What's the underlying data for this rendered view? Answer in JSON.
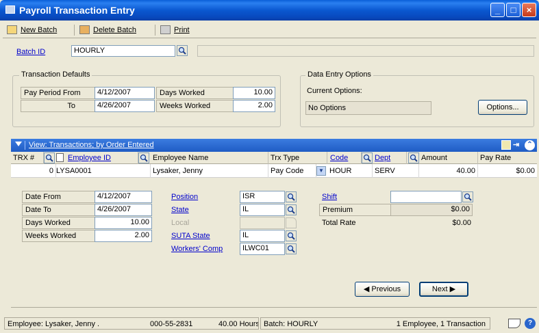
{
  "window": {
    "title": "Payroll Transaction Entry",
    "controls": {
      "minimize": "_",
      "maximize": "□",
      "close": "×"
    }
  },
  "toolbar": {
    "new_batch": "New Batch",
    "delete_batch": "Delete Batch",
    "print": "Print"
  },
  "batch": {
    "label": "Batch ID",
    "value": "HOURLY",
    "comment": ""
  },
  "defaults": {
    "group_title": "Transaction Defaults",
    "pay_period_from_label": "Pay Period From",
    "pay_period_from": "4/12/2007",
    "to_label": "To",
    "to": "4/26/2007",
    "days_worked_label": "Days Worked",
    "days_worked": "10.00",
    "weeks_worked_label": "Weeks Worked",
    "weeks_worked": "2.00"
  },
  "entry_options": {
    "group_title": "Data Entry Options",
    "current_label": "Current Options:",
    "current_value": "No Options",
    "options_button": "Options..."
  },
  "scroll": {
    "view_label": "View: Transactions; by Order Entered",
    "columns": {
      "trx": "TRX #",
      "employee_id": "Employee ID",
      "employee_name": "Employee Name",
      "trx_type": "Trx Type",
      "code": "Code",
      "dept": "Dept",
      "amount": "Amount",
      "pay_rate": "Pay Rate"
    },
    "row": {
      "trx": "0",
      "employee_id": "LYSA0001",
      "employee_name": "Lysaker, Jenny",
      "trx_type": "Pay Code",
      "code": "HOUR",
      "dept": "SERV",
      "amount": "40.00",
      "pay_rate": "$0.00"
    }
  },
  "detail": {
    "date_from_label": "Date From",
    "date_from": "4/12/2007",
    "date_to_label": "Date To",
    "date_to": "4/26/2007",
    "days_worked_label": "Days Worked",
    "days_worked": "10.00",
    "weeks_worked_label": "Weeks Worked",
    "weeks_worked": "2.00",
    "position_label": "Position",
    "position": "ISR",
    "state_label": "State",
    "state": "IL",
    "local_label": "Local",
    "local": "",
    "suta_label": "SUTA State",
    "suta": "IL",
    "workers_comp_label": "Workers' Comp",
    "workers_comp": "ILWC01",
    "shift_label": "Shift",
    "shift": "",
    "premium_label": "Premium",
    "premium": "$0.00",
    "total_rate_label": "Total Rate",
    "total_rate": "$0.00"
  },
  "nav": {
    "previous": "Previous",
    "next": "Next"
  },
  "status": {
    "employee": "Employee: Lysaker, Jenny .",
    "ssn": "000-55-2831",
    "hours": "40.00 Hours",
    "batch": "Batch: HOURLY",
    "count": "1 Employee, 1 Transaction"
  },
  "colors": {
    "title_blue": "#0a58d0",
    "view_bar": "#2a66cc",
    "link": "#0000cc",
    "window_bg": "#ece9d8"
  }
}
